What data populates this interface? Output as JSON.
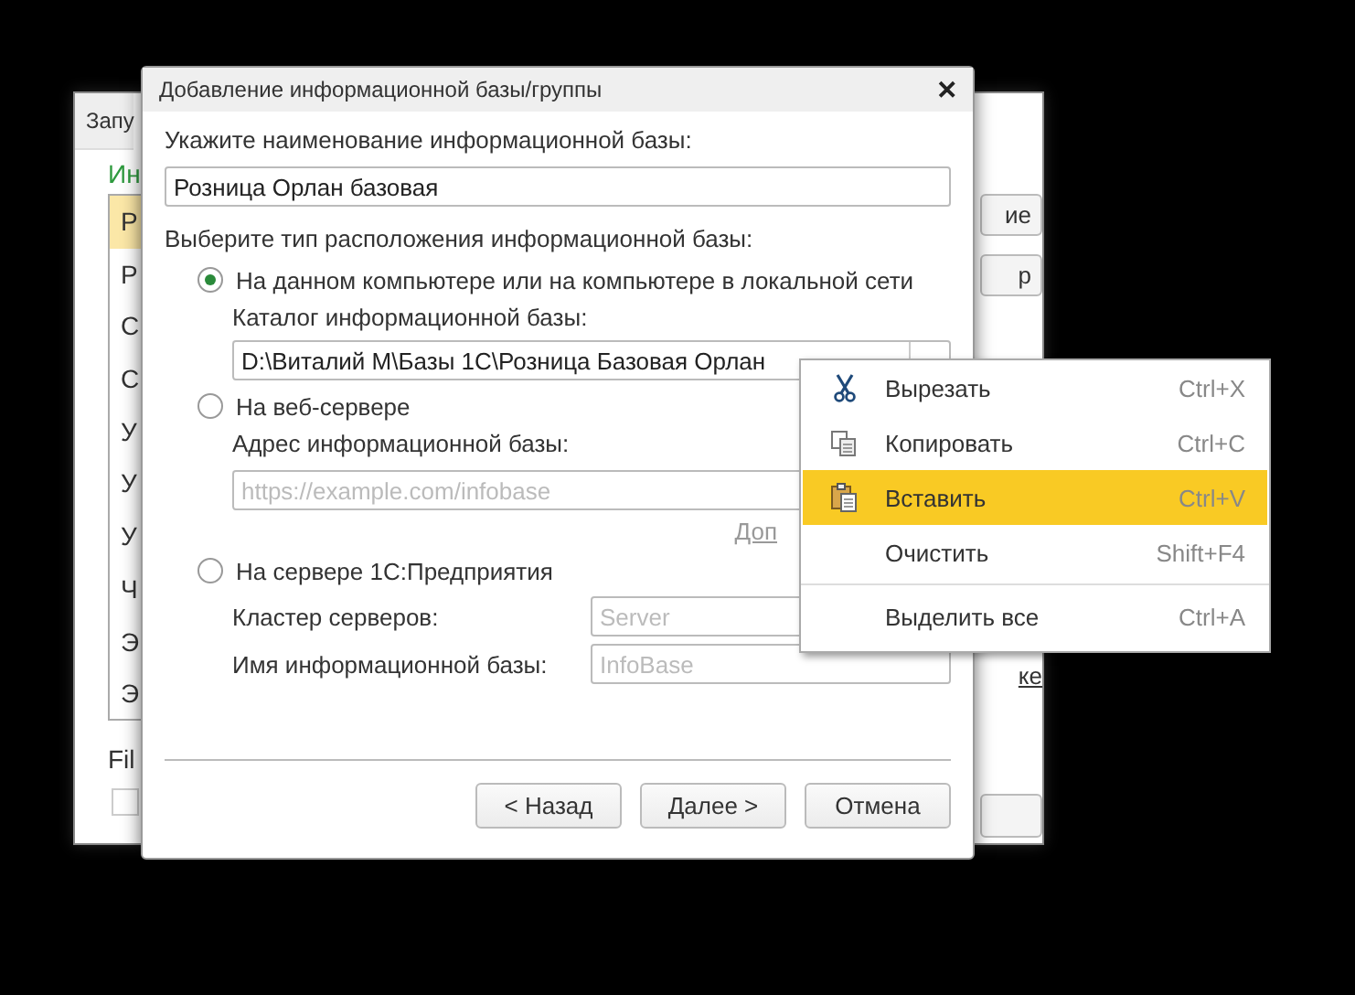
{
  "background_window": {
    "title": "Запу",
    "heading": "Ин",
    "list_items": [
      {
        "label": "Р",
        "selected": true
      },
      {
        "label": "Р",
        "selected": false
      },
      {
        "label": "С",
        "selected": false
      },
      {
        "label": "С",
        "selected": false
      },
      {
        "label": "У",
        "selected": false
      },
      {
        "label": "У",
        "selected": false
      },
      {
        "label": "У",
        "selected": false
      },
      {
        "label": "Ч",
        "selected": false
      },
      {
        "label": "Э",
        "selected": false
      },
      {
        "label": "Э",
        "selected": false
      }
    ],
    "side_buttons": [
      "ие",
      "р"
    ],
    "side_link": "ке",
    "footer_label": "Fil",
    "checkbox": {
      "checked": false
    }
  },
  "dialog": {
    "title": "Добавление информационной базы/группы",
    "close": "✕",
    "name_label": "Укажите наименование информационной базы:",
    "name_value": "Розница Орлан базовая",
    "type_label": "Выберите тип расположения информационной базы:",
    "options": [
      {
        "label": "На данном компьютере или на компьютере в локальной сети",
        "selected": true,
        "fields": [
          {
            "label": "Каталог информационной базы:",
            "value": "D:\\Виталий М\\Базы 1С\\Розница Базовая Орлан",
            "kind": "path"
          }
        ]
      },
      {
        "label": "На веб-сервере",
        "selected": false,
        "fields": [
          {
            "label": "Адрес информационной базы:",
            "placeholder": "https://example.com/infobase",
            "kind": "stacked"
          }
        ],
        "link": "Доп"
      },
      {
        "label": "На сервере 1С:Предприятия",
        "selected": false,
        "fields": [
          {
            "label": "Кластер серверов:",
            "placeholder": "Server",
            "kind": "inline"
          },
          {
            "label": "Имя информационной базы:",
            "placeholder": "InfoBase",
            "kind": "inline"
          }
        ]
      }
    ],
    "buttons": [
      "< Назад",
      "Далее >",
      "Отмена"
    ]
  },
  "context_menu": [
    {
      "kind": "cut",
      "label": "Вырезать",
      "shortcut": "Ctrl+X",
      "selected": false
    },
    {
      "kind": "copy",
      "label": "Копировать",
      "shortcut": "Ctrl+C",
      "selected": false
    },
    {
      "kind": "paste",
      "label": "Вставить",
      "shortcut": "Ctrl+V",
      "selected": true
    },
    {
      "kind": "item",
      "label": "Очистить",
      "shortcut": "Shift+F4",
      "selected": false
    },
    {
      "kind": "separator"
    },
    {
      "kind": "item",
      "label": "Выделить все",
      "shortcut": "Ctrl+A",
      "selected": false
    }
  ]
}
